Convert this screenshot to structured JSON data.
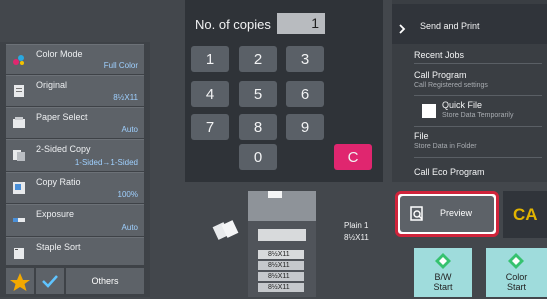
{
  "copies": {
    "label": "No. of copies",
    "value": "1"
  },
  "keypad": {
    "keys": [
      "1",
      "2",
      "3",
      "4",
      "5",
      "6",
      "7",
      "8",
      "9",
      "0"
    ],
    "clear_label": "C"
  },
  "settings": [
    {
      "label": "Color Mode",
      "value": "Full Color",
      "icon": "color-mode-icon"
    },
    {
      "label": "Original",
      "value": "8½X11",
      "icon": "original-icon"
    },
    {
      "label": "Paper Select",
      "value": "Auto",
      "icon": "paper-select-icon"
    },
    {
      "label": "2-Sided Copy",
      "value": "1-Sided→1-Sided",
      "icon": "two-sided-icon"
    },
    {
      "label": "Copy Ratio",
      "value": "100%",
      "icon": "copy-ratio-icon"
    },
    {
      "label": "Exposure",
      "value": "Auto",
      "icon": "exposure-icon"
    },
    {
      "label": "Staple Sort",
      "value": "",
      "icon": "staple-sort-icon"
    }
  ],
  "bottom": {
    "others_label": "Others"
  },
  "menu": {
    "header": "Send and Print",
    "items": [
      {
        "title": "Recent Jobs",
        "sub": ""
      },
      {
        "title": "Call Program",
        "sub": "Call Registered settings"
      },
      {
        "title": "Quick File",
        "sub": "Store Data Temporarily"
      },
      {
        "title": "File",
        "sub": "Store Data in Folder"
      },
      {
        "title": "Call Eco Program",
        "sub": ""
      }
    ]
  },
  "machine": {
    "output_label": "Plain 1",
    "output_size": "8½X11",
    "trays": [
      "8½X11",
      "8½X11",
      "8½X11",
      "8½X11"
    ]
  },
  "preview": {
    "label": "Preview",
    "ca_label": "CA"
  },
  "start": {
    "bw_label": "B/W\nStart",
    "color_label": "Color\nStart"
  },
  "colors": {
    "accent": "#e0266f",
    "highlight": "#d0243b",
    "start": "#9fdcdc",
    "ca": "#e2b400"
  }
}
